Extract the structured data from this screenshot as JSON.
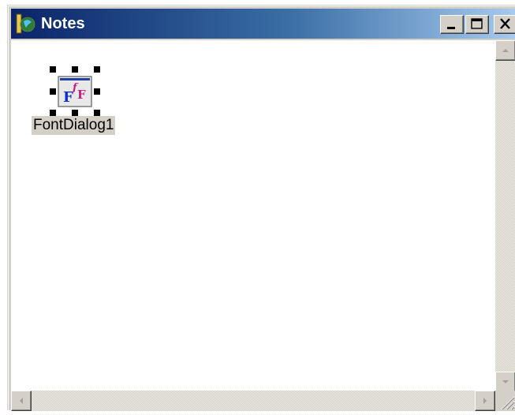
{
  "window": {
    "title": "Notes",
    "title_gradient": [
      "#0a246a",
      "#a6caf0"
    ],
    "buttons": {
      "minimize_icon": "minimize-icon",
      "maximize_icon": "maximize-icon",
      "close_icon": "close-icon"
    }
  },
  "designer": {
    "components": [
      {
        "label": "FontDialog1",
        "icon": "font-dialog-icon"
      }
    ]
  },
  "scrollbars": {
    "vertical": {
      "up_icon": "arrow-up-icon",
      "down_icon": "arrow-down-icon"
    },
    "horizontal": {
      "left_icon": "arrow-left-icon",
      "right_icon": "arrow-right-icon"
    }
  }
}
